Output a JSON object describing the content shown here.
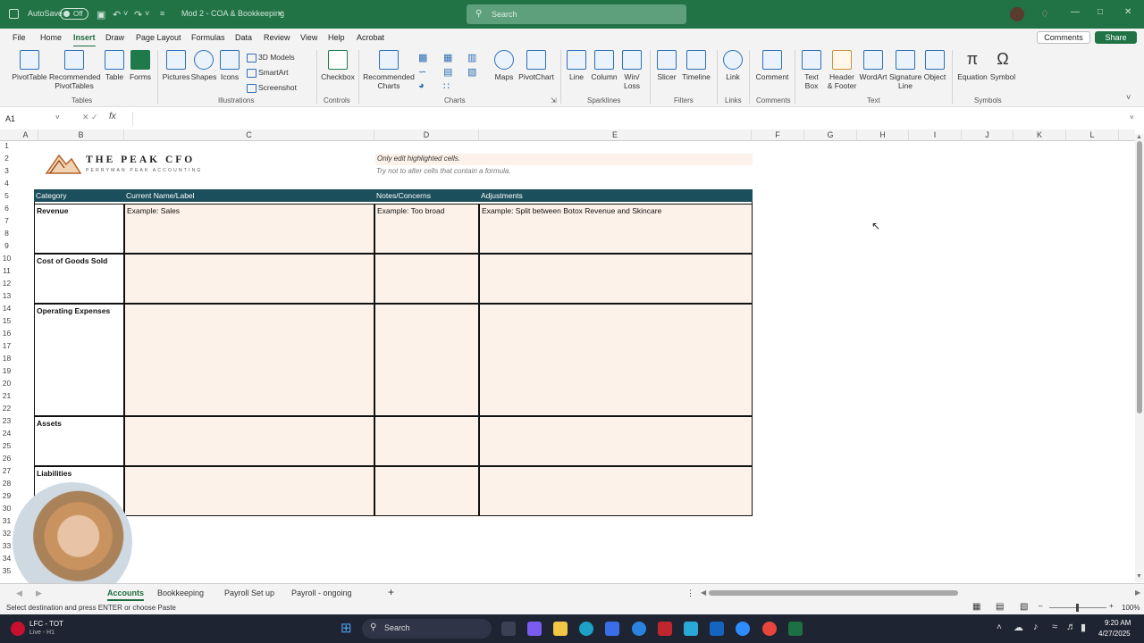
{
  "titlebar": {
    "autosave_label": "AutoSave",
    "autosave_state": "Off",
    "doc_title": "Mod 2 - COA & Bookkeeping",
    "search_placeholder": "Search"
  },
  "menu": {
    "tabs": [
      "File",
      "Home",
      "Insert",
      "Draw",
      "Page Layout",
      "Formulas",
      "Data",
      "Review",
      "View",
      "Help",
      "Acrobat"
    ],
    "active": "Insert",
    "comments_label": "Comments",
    "share_label": "Share"
  },
  "ribbon": {
    "tables": {
      "group": "Tables",
      "pivottable": "PivotTable",
      "recommended_pivot_line1": "Recommended",
      "recommended_pivot_line2": "PivotTables",
      "table": "Table",
      "forms": "Forms"
    },
    "illustrations": {
      "group": "Illustrations",
      "pictures": "Pictures",
      "shapes": "Shapes",
      "icons": "Icons",
      "models3d": "3D Models",
      "smartart": "SmartArt",
      "screenshot": "Screenshot"
    },
    "controls": {
      "group": "Controls",
      "checkbox": "Checkbox"
    },
    "charts": {
      "group": "Charts",
      "recommended_line1": "Recommended",
      "recommended_line2": "Charts",
      "maps": "Maps",
      "pivotchart": "PivotChart"
    },
    "sparklines": {
      "group": "Sparklines",
      "line": "Line",
      "column": "Column",
      "winloss_line1": "Win/",
      "winloss_line2": "Loss"
    },
    "filters": {
      "group": "Filters",
      "slicer": "Slicer",
      "timeline": "Timeline"
    },
    "links": {
      "group": "Links",
      "link": "Link"
    },
    "comments": {
      "group": "Comments",
      "comment": "Comment"
    },
    "text": {
      "group": "Text",
      "textbox_line1": "Text",
      "textbox_line2": "Box",
      "header_line1": "Header",
      "header_line2": "& Footer",
      "wordart": "WordArt",
      "signature_line1": "Signature",
      "signature_line2": "Line",
      "object": "Object"
    },
    "symbols": {
      "group": "Symbols",
      "equation": "Equation",
      "symbol": "Symbol"
    }
  },
  "formula_bar": {
    "name_box": "A1",
    "fx": "fx",
    "value": ""
  },
  "columns": [
    "A",
    "B",
    "C",
    "D",
    "E",
    "F",
    "G",
    "H",
    "I",
    "J",
    "K",
    "L"
  ],
  "rows": [
    "1",
    "2",
    "3",
    "4",
    "5",
    "6",
    "7",
    "8",
    "9",
    "10",
    "11",
    "12",
    "13",
    "14",
    "15",
    "16",
    "17",
    "18",
    "19",
    "20",
    "21",
    "22",
    "23",
    "24",
    "25",
    "26",
    "27",
    "28",
    "29",
    "30",
    "31",
    "32",
    "33",
    "34",
    "35"
  ],
  "sheet": {
    "logo_title": "THE PEAK CFO",
    "logo_subtitle": "PERRYMAN PEAK ACCOUNTING",
    "note1": "Only edit highlighted cells.",
    "note2": "Try not to alter cells that contain a formula.",
    "headers": [
      "Category",
      "Current Name/Label",
      "Notes/Concerns",
      "Adjustments"
    ],
    "categories": [
      "Revenue",
      "Cost of Goods Sold",
      "Operating Expenses",
      "Assets",
      "Liabilities"
    ],
    "example_name": "Example: Sales",
    "example_note": "Example: Too broad",
    "example_adjust": "Example: Split between Botox Revenue and Skincare",
    "header_color": "#1b4f5c",
    "highlight_color": "#fdf2e9"
  },
  "sheet_tabs": {
    "tabs": [
      "Accounts",
      "Bookkeeping",
      "Payroll Set up",
      "Payroll - ongoing"
    ],
    "active": "Accounts",
    "add": "+"
  },
  "status": {
    "message": "Select destination and press ENTER or choose Paste",
    "zoom": "100%"
  },
  "taskbar": {
    "weather_title": "LFC - TOT",
    "weather_sub": "Live - H1",
    "search_label": "Search",
    "time": "9:20 AM",
    "date": "4/27/2025"
  }
}
